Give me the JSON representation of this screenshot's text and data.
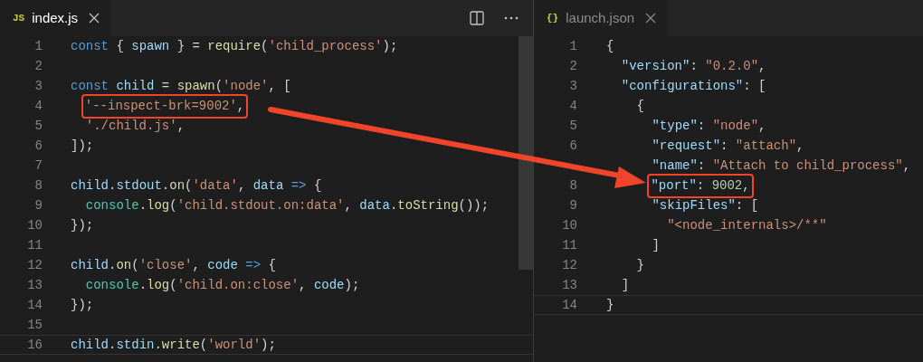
{
  "panes": [
    {
      "tab": {
        "icon": "JS",
        "label": "index.js",
        "focused": true
      },
      "lines": [
        {
          "n": "1",
          "current": false,
          "highlighted": false,
          "tokens": [
            {
              "kind": "kw",
              "t": "const"
            },
            {
              "kind": "p",
              "t": " { "
            },
            {
              "kind": "var",
              "t": "spawn"
            },
            {
              "kind": "p",
              "t": " } = "
            },
            {
              "kind": "fn",
              "t": "require"
            },
            {
              "kind": "p",
              "t": "("
            },
            {
              "kind": "str",
              "t": "'child_process'"
            },
            {
              "kind": "p",
              "t": ");"
            }
          ]
        },
        {
          "n": "2",
          "current": false,
          "highlighted": false
        },
        {
          "n": "3",
          "current": false,
          "highlighted": false,
          "tokens": [
            {
              "kind": "kw",
              "t": "const"
            },
            {
              "kind": "var",
              "t": " child"
            },
            {
              "kind": "p",
              "t": " = "
            },
            {
              "kind": "fn",
              "t": "spawn"
            },
            {
              "kind": "p",
              "t": "("
            },
            {
              "kind": "str",
              "t": "'node'"
            },
            {
              "kind": "p",
              "t": ", ["
            }
          ]
        },
        {
          "n": "4",
          "current": false,
          "highlighted": true,
          "tokens": [
            {
              "kind": "str",
              "t": "  '--inspect-brk=9002'"
            },
            {
              "kind": "p",
              "t": ","
            }
          ]
        },
        {
          "n": "5",
          "current": false,
          "highlighted": false,
          "tokens": [
            {
              "kind": "str",
              "t": "  './child.js'"
            },
            {
              "kind": "p",
              "t": ","
            }
          ]
        },
        {
          "n": "6",
          "current": false,
          "highlighted": false,
          "tokens": [
            {
              "kind": "p",
              "t": "]);"
            }
          ]
        },
        {
          "n": "7",
          "current": false,
          "highlighted": false
        },
        {
          "n": "8",
          "current": false,
          "highlighted": false,
          "tokens": [
            {
              "kind": "var",
              "t": "child"
            },
            {
              "kind": "p",
              "t": "."
            },
            {
              "kind": "var",
              "t": "stdout"
            },
            {
              "kind": "p",
              "t": "."
            },
            {
              "kind": "fn",
              "t": "on"
            },
            {
              "kind": "p",
              "t": "("
            },
            {
              "kind": "str",
              "t": "'data'"
            },
            {
              "kind": "p",
              "t": ", "
            },
            {
              "kind": "var",
              "t": "data"
            },
            {
              "kind": "kw",
              "t": " =>"
            },
            {
              "kind": "p",
              "t": " {"
            }
          ]
        },
        {
          "n": "9",
          "current": false,
          "highlighted": false,
          "tokens": [
            {
              "kind": "cls",
              "t": "  console"
            },
            {
              "kind": "p",
              "t": "."
            },
            {
              "kind": "fn",
              "t": "log"
            },
            {
              "kind": "p",
              "t": "("
            },
            {
              "kind": "str",
              "t": "'child.stdout.on:data'"
            },
            {
              "kind": "p",
              "t": ", "
            },
            {
              "kind": "var",
              "t": "data"
            },
            {
              "kind": "p",
              "t": "."
            },
            {
              "kind": "fn",
              "t": "toString"
            },
            {
              "kind": "p",
              "t": "());"
            }
          ]
        },
        {
          "n": "10",
          "current": false,
          "highlighted": false,
          "tokens": [
            {
              "kind": "p",
              "t": "});"
            }
          ]
        },
        {
          "n": "11",
          "current": false,
          "highlighted": false
        },
        {
          "n": "12",
          "current": false,
          "highlighted": false,
          "tokens": [
            {
              "kind": "var",
              "t": "child"
            },
            {
              "kind": "p",
              "t": "."
            },
            {
              "kind": "fn",
              "t": "on"
            },
            {
              "kind": "p",
              "t": "("
            },
            {
              "kind": "str",
              "t": "'close'"
            },
            {
              "kind": "p",
              "t": ", "
            },
            {
              "kind": "var",
              "t": "code"
            },
            {
              "kind": "kw",
              "t": " =>"
            },
            {
              "kind": "p",
              "t": " {"
            }
          ]
        },
        {
          "n": "13",
          "current": false,
          "highlighted": false,
          "tokens": [
            {
              "kind": "cls",
              "t": "  console"
            },
            {
              "kind": "p",
              "t": "."
            },
            {
              "kind": "fn",
              "t": "log"
            },
            {
              "kind": "p",
              "t": "("
            },
            {
              "kind": "str",
              "t": "'child.on:close'"
            },
            {
              "kind": "p",
              "t": ", "
            },
            {
              "kind": "var",
              "t": "code"
            },
            {
              "kind": "p",
              "t": ");"
            }
          ]
        },
        {
          "n": "14",
          "current": false,
          "highlighted": false,
          "tokens": [
            {
              "kind": "p",
              "t": "});"
            }
          ]
        },
        {
          "n": "15",
          "current": false,
          "highlighted": false
        },
        {
          "n": "16",
          "current": true,
          "highlighted": false,
          "tokens": [
            {
              "kind": "var",
              "t": "child"
            },
            {
              "kind": "p",
              "t": "."
            },
            {
              "kind": "var",
              "t": "stdin"
            },
            {
              "kind": "p",
              "t": "."
            },
            {
              "kind": "fn",
              "t": "write"
            },
            {
              "kind": "p",
              "t": "("
            },
            {
              "kind": "str",
              "t": "'world'"
            },
            {
              "kind": "p",
              "t": ");"
            }
          ]
        }
      ]
    },
    {
      "tab": {
        "icon": "{}",
        "label": "launch.json",
        "focused": false
      },
      "lines": [
        {
          "n": "1",
          "current": false,
          "highlighted": false,
          "tokens": [
            {
              "kind": "p",
              "t": "{"
            }
          ]
        },
        {
          "n": "2",
          "current": false,
          "highlighted": false,
          "tokens": [
            {
              "kind": "var",
              "t": "  \"version\""
            },
            {
              "kind": "p",
              "t": ": "
            },
            {
              "kind": "str",
              "t": "\"0.2.0\""
            },
            {
              "kind": "p",
              "t": ","
            }
          ]
        },
        {
          "n": "3",
          "current": false,
          "highlighted": false,
          "tokens": [
            {
              "kind": "var",
              "t": "  \"configurations\""
            },
            {
              "kind": "p",
              "t": ": ["
            }
          ]
        },
        {
          "n": "4",
          "current": false,
          "highlighted": false,
          "tokens": [
            {
              "kind": "p",
              "t": "    {"
            }
          ]
        },
        {
          "n": "5",
          "current": false,
          "highlighted": false,
          "tokens": [
            {
              "kind": "var",
              "t": "      \"type\""
            },
            {
              "kind": "p",
              "t": ": "
            },
            {
              "kind": "str",
              "t": "\"node\""
            },
            {
              "kind": "p",
              "t": ","
            }
          ]
        },
        {
          "n": "6",
          "current": false,
          "highlighted": false,
          "tokens": [
            {
              "kind": "var",
              "t": "      \"request\""
            },
            {
              "kind": "p",
              "t": ": "
            },
            {
              "kind": "str",
              "t": "\"attach\""
            },
            {
              "kind": "p",
              "t": ","
            }
          ]
        },
        {
          "current": false,
          "highlighted": false,
          "tokens": [
            {
              "kind": "var",
              "t": "      \"name\""
            },
            {
              "kind": "p",
              "t": ": "
            },
            {
              "kind": "str",
              "t": "\"Attach to child_process\""
            },
            {
              "kind": "p",
              "t": ","
            }
          ]
        },
        {
          "n": "8",
          "current": false,
          "highlighted": true,
          "tokens": [
            {
              "kind": "var",
              "t": "      \"port\""
            },
            {
              "kind": "p",
              "t": ": "
            },
            {
              "kind": "num",
              "t": "9002"
            },
            {
              "kind": "p",
              "t": ","
            }
          ]
        },
        {
          "n": "9",
          "current": false,
          "highlighted": false,
          "tokens": [
            {
              "kind": "var",
              "t": "      \"skipFiles\""
            },
            {
              "kind": "p",
              "t": ": ["
            }
          ]
        },
        {
          "n": "10",
          "current": false,
          "highlighted": false,
          "tokens": [
            {
              "kind": "str",
              "t": "        \"<node_internals>/**\""
            }
          ]
        },
        {
          "n": "11",
          "current": false,
          "highlighted": false,
          "tokens": [
            {
              "kind": "p",
              "t": "      ]"
            }
          ]
        },
        {
          "n": "12",
          "current": false,
          "highlighted": false,
          "tokens": [
            {
              "kind": "p",
              "t": "    }"
            }
          ]
        },
        {
          "n": "13",
          "current": false,
          "highlighted": false,
          "tokens": [
            {
              "kind": "p",
              "t": "  ]"
            }
          ]
        },
        {
          "n": "14",
          "current": true,
          "highlighted": false,
          "tokens": [
            {
              "kind": "p",
              "t": "}"
            }
          ]
        }
      ]
    }
  ]
}
